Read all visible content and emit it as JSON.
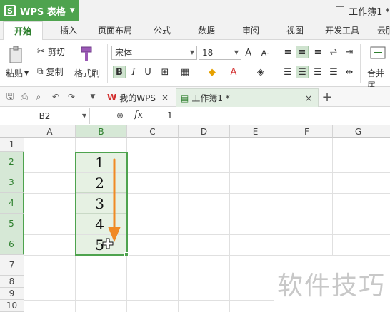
{
  "app": {
    "name": "WPS 表格",
    "doc_title": "工作簿1 *"
  },
  "menu": {
    "tabs": [
      "开始",
      "插入",
      "页面布局",
      "公式",
      "数据",
      "审阅",
      "视图",
      "开发工具",
      "云服"
    ]
  },
  "ribbon": {
    "cut": "剪切",
    "paste": "粘贴",
    "copy": "复制",
    "format_painter": "格式刷",
    "font_name": "宋体",
    "font_size": "18",
    "merge": "合并居"
  },
  "doc_tabs": [
    {
      "label": "我的WPS"
    },
    {
      "label": "工作簿1 *"
    }
  ],
  "formula_bar": {
    "cell_ref": "B2",
    "fx": "fx",
    "value": "1"
  },
  "grid": {
    "columns": [
      "A",
      "B",
      "C",
      "D",
      "E",
      "F",
      "G"
    ],
    "rows": [
      "1",
      "2",
      "3",
      "4",
      "5",
      "6",
      "7",
      "8",
      "9",
      "10"
    ],
    "b_values": [
      "1",
      "2",
      "3",
      "4",
      "5"
    ]
  },
  "colors": {
    "accent": "#4ea34e",
    "arrow": "#f08a24",
    "selection_fill": "#e6f1e3"
  },
  "watermark": "软件技巧"
}
